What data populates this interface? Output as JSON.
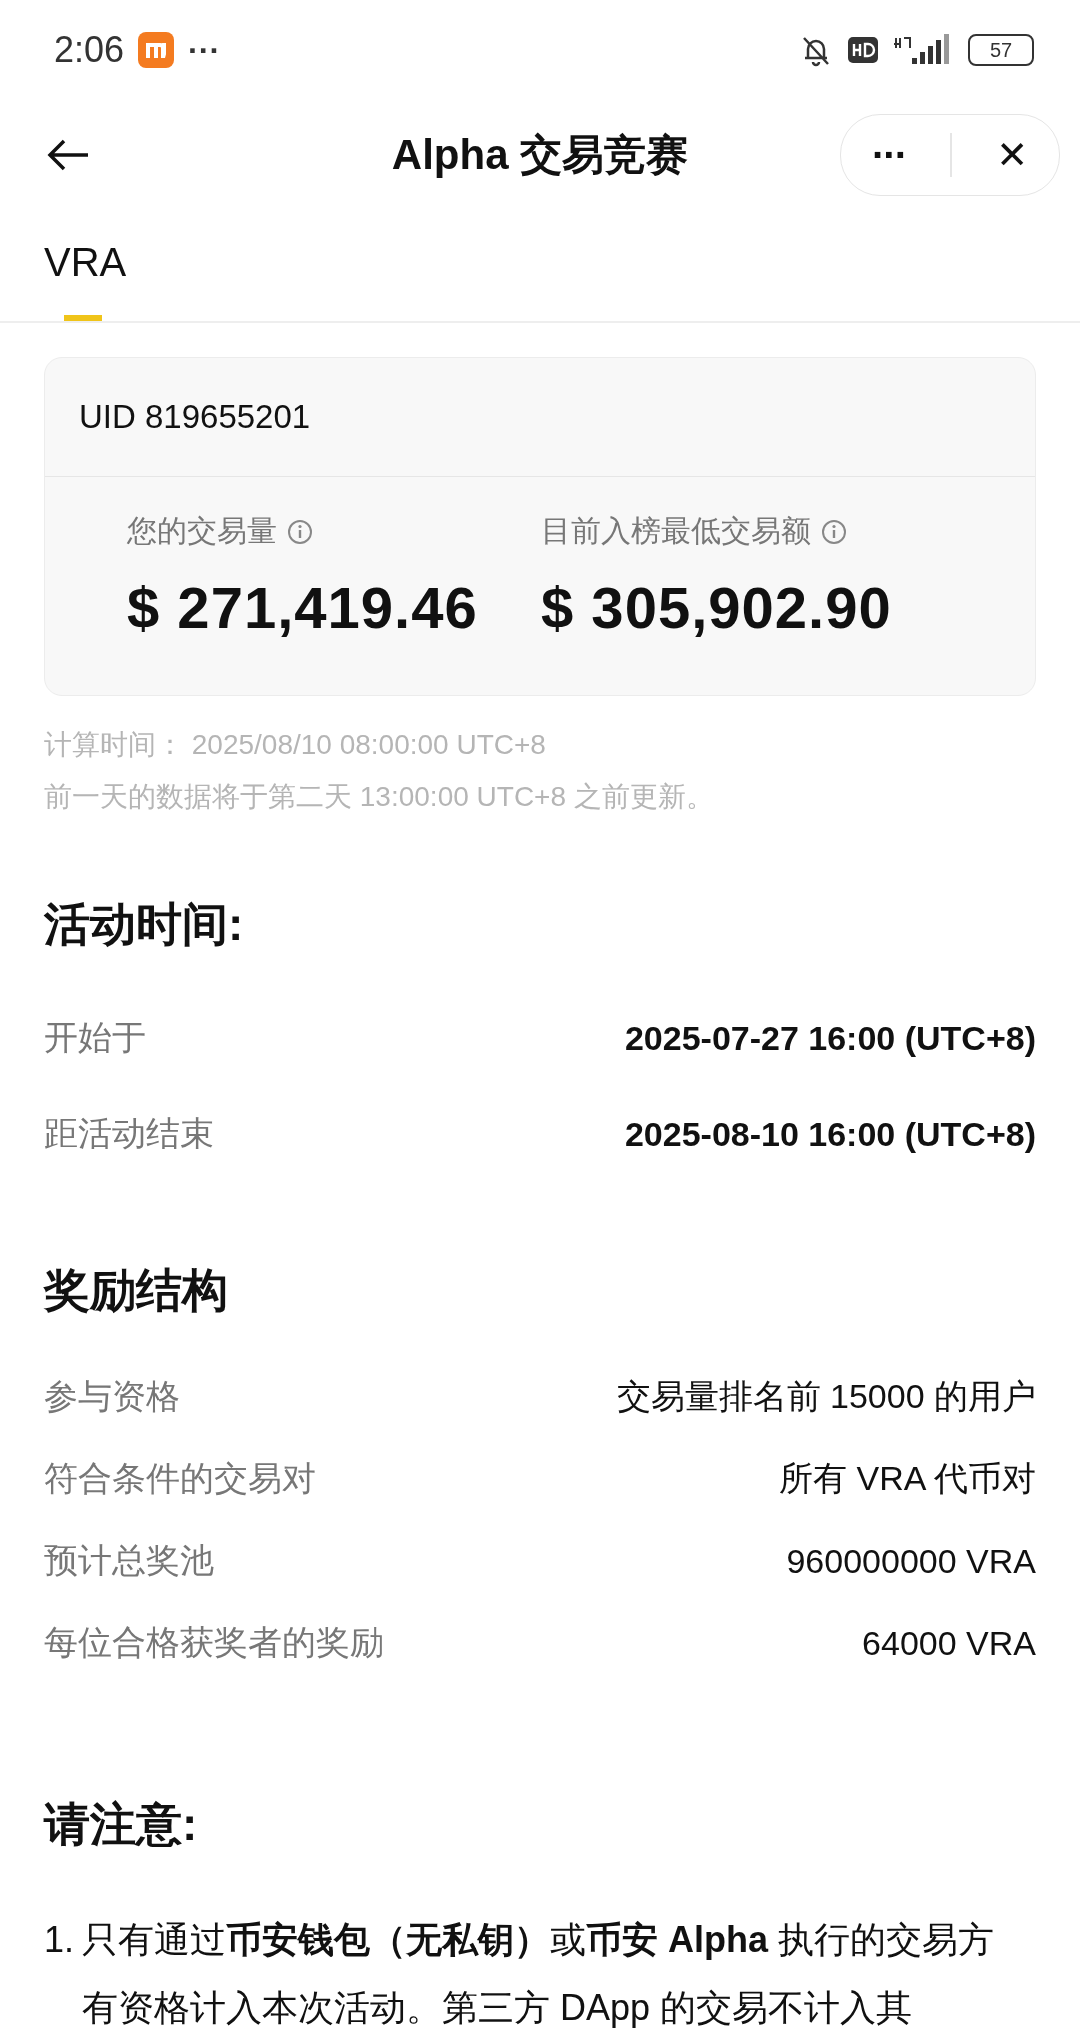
{
  "status_bar": {
    "time": "2:06",
    "more": "···",
    "battery": "57"
  },
  "header": {
    "title": "Alpha 交易竞赛",
    "more": "···",
    "close": "✕"
  },
  "tabs": [
    {
      "label": "VRA",
      "selected": true
    }
  ],
  "card": {
    "uid": "UID 819655201",
    "stats": [
      {
        "label": "您的交易量",
        "value": "$ 271,419.46"
      },
      {
        "label": "目前入榜最低交易额",
        "value": "$ 305,902.90"
      }
    ]
  },
  "notes": [
    "计算时间：  2025/08/10 08:00:00 UTC+8",
    "前一天的数据将于第二天 13:00:00 UTC+8 之前更新。"
  ],
  "sections": [
    {
      "title": "活动时间:",
      "rows": [
        {
          "label": "开始于",
          "value": "2025-07-27 16:00 (UTC+8)",
          "kind": "bold"
        },
        {
          "label": "距活动结束",
          "value": "2025-08-10 16:00 (UTC+8)",
          "kind": "bold"
        }
      ]
    },
    {
      "title": "奖励结构",
      "rows": [
        {
          "label": "参与资格",
          "value": "交易量排名前 15000 的用户",
          "kind": "plain"
        },
        {
          "label": "符合条件的交易对",
          "value": "所有 VRA 代币对",
          "kind": "plain"
        },
        {
          "label": "预计总奖池",
          "value": "960000000 VRA",
          "kind": "plain"
        },
        {
          "label": "每位合格获奖者的奖励",
          "value": "64000 VRA",
          "kind": "plain"
        }
      ]
    }
  ],
  "notice": {
    "title": "请注意:",
    "items": [
      {
        "number": "1.",
        "text": "只有通过**币安钱包（无私钥）**或**币安 Alpha** 执行的交易方有资格计入本次活动。第三方 DApp 的交易不计入其"
      }
    ]
  }
}
